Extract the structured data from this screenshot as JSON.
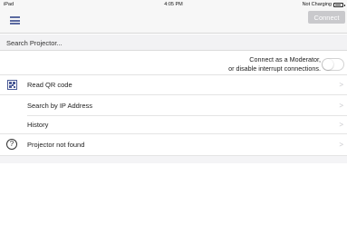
{
  "status_bar": {
    "carrier": "iPad",
    "time": "4:05 PM",
    "battery_text": "Not Charging"
  },
  "nav": {
    "connect_label": "Connect"
  },
  "search": {
    "placeholder": "Search Projector..."
  },
  "moderator": {
    "line1": "Connect as a Moderator,",
    "line2": "or disable interrupt connections.",
    "toggle_on": false
  },
  "menu": {
    "read_qr": "Read QR code",
    "search_ip": "Search by IP Address",
    "history": "History",
    "not_found": "Projector not found",
    "chevron": ">"
  },
  "icons": {
    "menu": "hamburger-menu-icon",
    "qr": "qr-code-icon",
    "help": "question-mark-icon",
    "battery": "battery-icon"
  },
  "colors": {
    "accent": "#5b6aa0",
    "button_disabled": "#c9c9cc"
  }
}
